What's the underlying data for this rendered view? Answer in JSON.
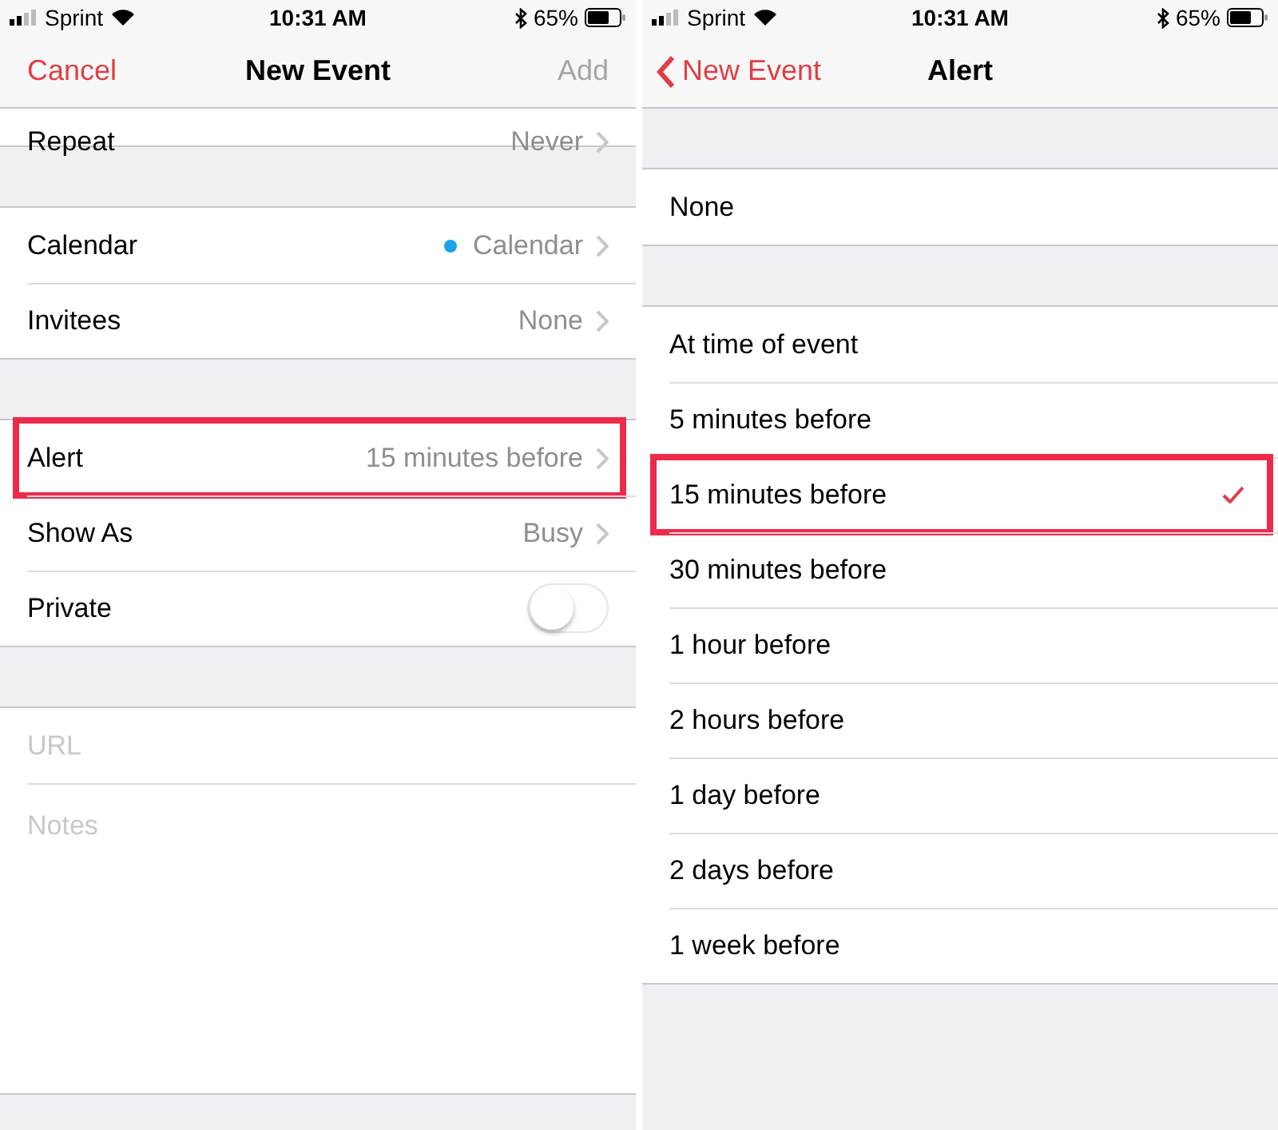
{
  "screens": [
    {
      "status_bar": {
        "carrier": "Sprint",
        "time": "10:31 AM",
        "battery": "65%"
      },
      "nav": {
        "left": {
          "kind": "text",
          "label": "Cancel"
        },
        "title": "New Event",
        "right": {
          "label": "Add",
          "disabled": true
        }
      },
      "groups": [
        [
          {
            "kind": "cut",
            "label": "Repeat",
            "value": "Never",
            "highlighted": false
          }
        ],
        [
          {
            "kind": "dot-value",
            "label": "Calendar",
            "value": "Calendar",
            "color": "#1aa3ed",
            "highlighted": false
          },
          {
            "kind": "value",
            "label": "Invitees",
            "value": "None",
            "highlighted": false
          }
        ],
        [
          {
            "kind": "value",
            "label": "Alert",
            "value": "15 minutes before",
            "highlighted": true
          },
          {
            "kind": "value",
            "label": "Show As",
            "value": "Busy",
            "highlighted": false
          },
          {
            "kind": "toggle",
            "label": "Private",
            "on": false,
            "highlighted": false
          }
        ],
        [
          {
            "kind": "field",
            "placeholder": "URL",
            "highlighted": false
          },
          {
            "kind": "notes",
            "placeholder": "Notes",
            "highlighted": false
          }
        ]
      ]
    },
    {
      "status_bar": {
        "carrier": "Sprint",
        "time": "10:31 AM",
        "battery": "65%"
      },
      "nav": {
        "left": {
          "kind": "back",
          "label": "New Event"
        },
        "title": "Alert"
      },
      "groups": [
        [
          {
            "kind": "option",
            "label": "None",
            "selected": false,
            "highlighted": false
          }
        ],
        [
          {
            "kind": "option",
            "label": "At time of event",
            "selected": false,
            "highlighted": false
          },
          {
            "kind": "option",
            "label": "5 minutes before",
            "selected": false,
            "highlighted": false
          },
          {
            "kind": "option",
            "label": "15 minutes before",
            "selected": true,
            "highlighted": true
          },
          {
            "kind": "option",
            "label": "30 minutes before",
            "selected": false,
            "highlighted": false
          },
          {
            "kind": "option",
            "label": "1 hour before",
            "selected": false,
            "highlighted": false
          },
          {
            "kind": "option",
            "label": "2 hours before",
            "selected": false,
            "highlighted": false
          },
          {
            "kind": "option",
            "label": "1 day before",
            "selected": false,
            "highlighted": false
          },
          {
            "kind": "option",
            "label": "2 days before",
            "selected": false,
            "highlighted": false
          },
          {
            "kind": "option",
            "label": "1 week before",
            "selected": false,
            "highlighted": false
          }
        ]
      ]
    }
  ]
}
